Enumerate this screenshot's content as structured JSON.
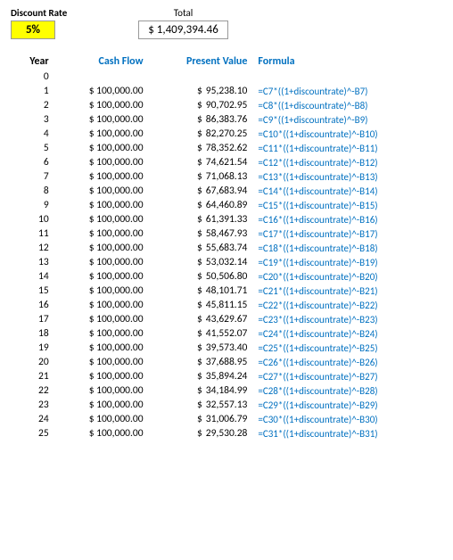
{
  "header": {
    "discount_label": "Discount Rate",
    "discount_value": "5%",
    "total_label": "Total",
    "total_value": "$ 1,409,394.46"
  },
  "table": {
    "columns": [
      "Year",
      "Cash Flow",
      "Present Value",
      "Formula"
    ],
    "rows": [
      {
        "year": "0",
        "cash_flow": "",
        "pv": "",
        "formula": ""
      },
      {
        "year": "1",
        "cash_flow": "$ 100,000.00",
        "pv_dollar": "$",
        "pv": "95,238.10",
        "formula": "=C7*((1+discountrate)^-B7)"
      },
      {
        "year": "2",
        "cash_flow": "$ 100,000.00",
        "pv_dollar": "$",
        "pv": "90,702.95",
        "formula": "=C8*((1+discountrate)^-B8)"
      },
      {
        "year": "3",
        "cash_flow": "$ 100,000.00",
        "pv_dollar": "$",
        "pv": "86,383.76",
        "formula": "=C9*((1+discountrate)^-B9)"
      },
      {
        "year": "4",
        "cash_flow": "$ 100,000.00",
        "pv_dollar": "$",
        "pv": "82,270.25",
        "formula": "=C10*((1+discountrate)^-B10)"
      },
      {
        "year": "5",
        "cash_flow": "$ 100,000.00",
        "pv_dollar": "$",
        "pv": "78,352.62",
        "formula": "=C11*((1+discountrate)^-B11)"
      },
      {
        "year": "6",
        "cash_flow": "$ 100,000.00",
        "pv_dollar": "$",
        "pv": "74,621.54",
        "formula": "=C12*((1+discountrate)^-B12)"
      },
      {
        "year": "7",
        "cash_flow": "$ 100,000.00",
        "pv_dollar": "$",
        "pv": "71,068.13",
        "formula": "=C13*((1+discountrate)^-B13)"
      },
      {
        "year": "8",
        "cash_flow": "$ 100,000.00",
        "pv_dollar": "$",
        "pv": "67,683.94",
        "formula": "=C14*((1+discountrate)^-B14)"
      },
      {
        "year": "9",
        "cash_flow": "$ 100,000.00",
        "pv_dollar": "$",
        "pv": "64,460.89",
        "formula": "=C15*((1+discountrate)^-B15)"
      },
      {
        "year": "10",
        "cash_flow": "$ 100,000.00",
        "pv_dollar": "$",
        "pv": "61,391.33",
        "formula": "=C16*((1+discountrate)^-B16)"
      },
      {
        "year": "11",
        "cash_flow": "$ 100,000.00",
        "pv_dollar": "$",
        "pv": "58,467.93",
        "formula": "=C17*((1+discountrate)^-B17)"
      },
      {
        "year": "12",
        "cash_flow": "$ 100,000.00",
        "pv_dollar": "$",
        "pv": "55,683.74",
        "formula": "=C18*((1+discountrate)^-B18)"
      },
      {
        "year": "13",
        "cash_flow": "$ 100,000.00",
        "pv_dollar": "$",
        "pv": "53,032.14",
        "formula": "=C19*((1+discountrate)^-B19)"
      },
      {
        "year": "14",
        "cash_flow": "$ 100,000.00",
        "pv_dollar": "$",
        "pv": "50,506.80",
        "formula": "=C20*((1+discountrate)^-B20)"
      },
      {
        "year": "15",
        "cash_flow": "$ 100,000.00",
        "pv_dollar": "$",
        "pv": "48,101.71",
        "formula": "=C21*((1+discountrate)^-B21)"
      },
      {
        "year": "16",
        "cash_flow": "$ 100,000.00",
        "pv_dollar": "$",
        "pv": "45,811.15",
        "formula": "=C22*((1+discountrate)^-B22)"
      },
      {
        "year": "17",
        "cash_flow": "$ 100,000.00",
        "pv_dollar": "$",
        "pv": "43,629.67",
        "formula": "=C23*((1+discountrate)^-B23)"
      },
      {
        "year": "18",
        "cash_flow": "$ 100,000.00",
        "pv_dollar": "$",
        "pv": "41,552.07",
        "formula": "=C24*((1+discountrate)^-B24)"
      },
      {
        "year": "19",
        "cash_flow": "$ 100,000.00",
        "pv_dollar": "$",
        "pv": "39,573.40",
        "formula": "=C25*((1+discountrate)^-B25)"
      },
      {
        "year": "20",
        "cash_flow": "$ 100,000.00",
        "pv_dollar": "$",
        "pv": "37,688.95",
        "formula": "=C26*((1+discountrate)^-B26)"
      },
      {
        "year": "21",
        "cash_flow": "$ 100,000.00",
        "pv_dollar": "$",
        "pv": "35,894.24",
        "formula": "=C27*((1+discountrate)^-B27)"
      },
      {
        "year": "22",
        "cash_flow": "$ 100,000.00",
        "pv_dollar": "$",
        "pv": "34,184.99",
        "formula": "=C28*((1+discountrate)^-B28)"
      },
      {
        "year": "23",
        "cash_flow": "$ 100,000.00",
        "pv_dollar": "$",
        "pv": "32,557.13",
        "formula": "=C29*((1+discountrate)^-B29)"
      },
      {
        "year": "24",
        "cash_flow": "$ 100,000.00",
        "pv_dollar": "$",
        "pv": "31,006.79",
        "formula": "=C30*((1+discountrate)^-B30)"
      },
      {
        "year": "25",
        "cash_flow": "$ 100,000.00",
        "pv_dollar": "$",
        "pv": "29,530.28",
        "formula": "=C31*((1+discountrate)^-B31)"
      }
    ]
  }
}
